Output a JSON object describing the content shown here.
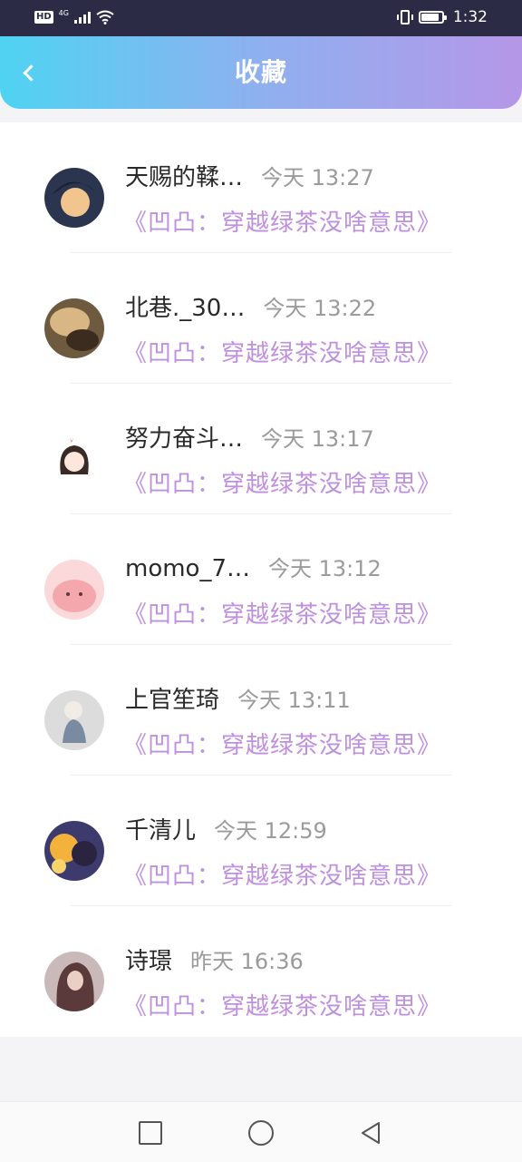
{
  "status_bar": {
    "hd": "HD",
    "network": "4G",
    "time": "1:32",
    "battery_level": 0.8
  },
  "header": {
    "back_icon": "chevron-left-icon",
    "title": "收藏"
  },
  "favorites": [
    {
      "name": "天赐的鞣…",
      "time": "今天 13:27",
      "book": "《凹凸：穿越绿茶没啥意思》",
      "avatar_color": "#2b3550",
      "avatar_accent": "#f2c48e"
    },
    {
      "name": "北巷._30…",
      "time": "今天 13:22",
      "book": "《凹凸：穿越绿茶没啥意思》",
      "avatar_color": "#6d5a3f",
      "avatar_accent": "#d8b784"
    },
    {
      "name": "努力奋斗…",
      "time": "今天 13:17",
      "book": "《凹凸：穿越绿茶没啥意思》",
      "avatar_color": "#ffffff",
      "avatar_accent": "#3a2a25"
    },
    {
      "name": "momo_7…",
      "time": "今天 13:12",
      "book": "《凹凸：穿越绿茶没啥意思》",
      "avatar_color": "#fbd8da",
      "avatar_accent": "#f4a8ad"
    },
    {
      "name": "上官笙琦",
      "time": "今天 13:11",
      "book": "《凹凸：穿越绿茶没啥意思》",
      "avatar_color": "#dcdcdc",
      "avatar_accent": "#7a8aa0"
    },
    {
      "name": "千清儿",
      "time": "今天 12:59",
      "book": "《凹凸：穿越绿茶没啥意思》",
      "avatar_color": "#3d3a6e",
      "avatar_accent": "#f3b23b"
    },
    {
      "name": "诗璟",
      "time": "昨天 16:36",
      "book": "《凹凸：穿越绿茶没啥意思》",
      "avatar_color": "#c9b9b9",
      "avatar_accent": "#5a3a3a"
    }
  ],
  "navbar": {
    "recent_icon": "square-icon",
    "home_icon": "circle-icon",
    "back_icon": "triangle-back-icon"
  },
  "colors": {
    "header_gradient": [
      "#4fd3f3",
      "#8fb0ef",
      "#b597e8"
    ],
    "book_title": "#bf8fe0",
    "time": "#9b9b9b"
  }
}
